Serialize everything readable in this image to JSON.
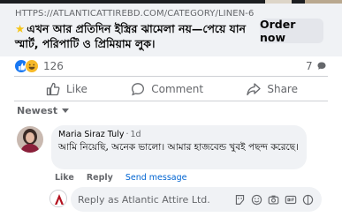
{
  "link": {
    "url": "HTTPS://ATLANTICATTIREBD.COM/CATEGORY/LINEN-60...",
    "title": "এখন আর প্রতিদিন ইস্ত্রির ঝামেলা নয়—পেয়ে যান স্মার্ট, পরিপাটি ও প্রিমিয়াম লুক।",
    "cta": "Order now"
  },
  "post": {
    "reaction_count": "126",
    "comment_count": "7",
    "actions": {
      "like": "Like",
      "comment": "Comment",
      "share": "Share"
    }
  },
  "comments": {
    "sort_label": "Newest",
    "items": [
      {
        "author": "Maria Siraz Tuly",
        "time": "1d",
        "text": "আমি নিয়েছি, অনেক ভালো। আমার হাজবেন্ড খুবই পছন্দ করেছে।",
        "actions": {
          "like": "Like",
          "reply": "Reply",
          "send": "Send message"
        }
      }
    ],
    "reply_placeholder": "Reply as Atlantic Attire Ltd."
  },
  "icons": [
    "star-icon",
    "like-reaction-icon",
    "haha-reaction-icon",
    "speech-bubble-icon",
    "thumbs-up-icon",
    "comment-icon",
    "share-icon",
    "chevron-down-icon",
    "sticker-icon",
    "emoji-icon",
    "camera-icon",
    "gif-icon",
    "sticker-badge-icon"
  ],
  "colors": {
    "accent": "#1877f2",
    "link_blue": "#0064d1",
    "muted": "#65676b",
    "card_bg": "#f0f2f5",
    "button_bg": "#e4e6eb"
  }
}
